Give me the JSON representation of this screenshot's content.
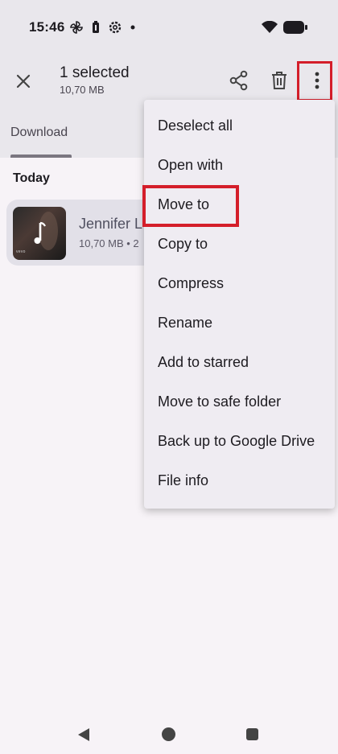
{
  "status_bar": {
    "time": "15:46",
    "icons": [
      "pinwheel-icon",
      "battery-saver-icon",
      "settings-icon",
      "dot-icon",
      "wifi-icon",
      "battery-icon"
    ]
  },
  "app_bar": {
    "title": "1 selected",
    "subtitle": "10,70 MB",
    "actions": [
      "close-icon",
      "share-icon",
      "delete-icon",
      "more-vert-icon"
    ]
  },
  "tabs": {
    "download": "Download"
  },
  "content": {
    "section": "Today",
    "file": {
      "name": "Jennifer L",
      "meta": "10,70 MB • 2",
      "thumb_badge": "vevo"
    }
  },
  "menu": {
    "items": [
      "Deselect all",
      "Open with",
      "Move to",
      "Copy to",
      "Compress",
      "Rename",
      "Add to starred",
      "Move to safe folder",
      "Back up to Google Drive",
      "File info"
    ]
  },
  "colors": {
    "highlight": "#d41e2a",
    "app_bar_bg": "#e9e7ec",
    "menu_bg": "#efecf2"
  }
}
